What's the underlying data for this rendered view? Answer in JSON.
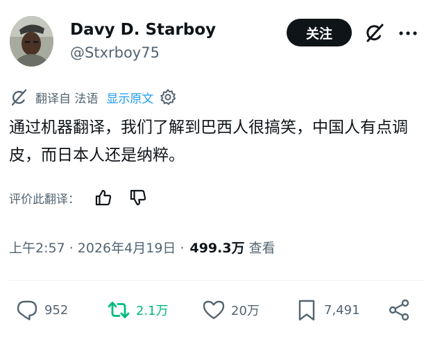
{
  "author": {
    "name": "Davy D. Starboy",
    "handle": "@Stxrboy75"
  },
  "header": {
    "follow_label": "关注"
  },
  "translation": {
    "from_label": "翻译自 法语",
    "show_original_label": "显示原文"
  },
  "tweet": {
    "text": "通过机器翻译，我们了解到巴西人很搞笑，中国人有点调皮，而日本人还是纳粹。"
  },
  "rating": {
    "label": "评价此翻译："
  },
  "meta": {
    "timestamp": "上午2:57 · 2026年4月19日 ·",
    "views_count": "499.3万",
    "views_label": "查看"
  },
  "actions": {
    "replies": "952",
    "retweets": "2.1万",
    "likes": "20万",
    "bookmarks": "7,491"
  },
  "colors": {
    "text_primary": "#0f1419",
    "text_secondary": "#536471",
    "link_blue": "#1d9bf0",
    "retweet_green": "#00ba7c",
    "follow_bg": "#0f1419"
  },
  "icons": {
    "grok": "grok-icon",
    "more": "more-icon",
    "translate": "translate-icon",
    "settings": "gear-icon",
    "thumb_up": "thumb-up-icon",
    "thumb_down": "thumb-down-icon",
    "reply": "reply-icon",
    "retweet": "retweet-icon",
    "like": "heart-icon",
    "bookmark": "bookmark-icon",
    "share": "share-icon"
  }
}
